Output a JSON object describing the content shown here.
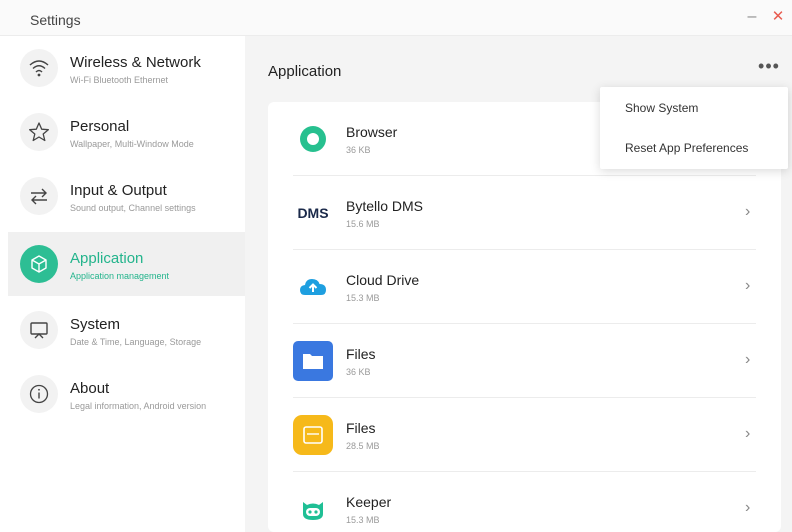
{
  "window": {
    "title": "Settings",
    "minimize_icon": "minimize-icon",
    "close_icon": "close-icon"
  },
  "sidebar": {
    "items": [
      {
        "title": "Wireless & Network",
        "subtitle": "Wi-Fi Bluetooth Ethernet",
        "icon": "wifi-icon",
        "active": false
      },
      {
        "title": "Personal",
        "subtitle": "Wallpaper, Multi-Window Mode",
        "icon": "star-icon",
        "active": false
      },
      {
        "title": "Input & Output",
        "subtitle": "Sound output, Channel settings",
        "icon": "swap-arrows-icon",
        "active": false
      },
      {
        "title": "Application",
        "subtitle": "Application management",
        "icon": "cube-icon",
        "active": true
      },
      {
        "title": "System",
        "subtitle": "Date & Time, Language, Storage",
        "icon": "monitor-icon",
        "active": false
      },
      {
        "title": "About",
        "subtitle": "Legal information, Android version",
        "icon": "info-icon",
        "active": false
      }
    ]
  },
  "main": {
    "title": "Application",
    "more_label": "•••",
    "apps": [
      {
        "name": "Browser",
        "size": "36 KB",
        "icon": "browser-icon"
      },
      {
        "name": "Bytello DMS",
        "size": "15.6 MB",
        "icon": "dms-icon",
        "icon_text": "DMS"
      },
      {
        "name": "Cloud Drive",
        "size": "15.3 MB",
        "icon": "cloud-drive-icon"
      },
      {
        "name": "Files",
        "size": "36 KB",
        "icon": "folder-icon"
      },
      {
        "name": "Files",
        "size": "28.5 MB",
        "icon": "files-yellow-icon"
      },
      {
        "name": "Keeper",
        "size": "15.3 MB",
        "icon": "keeper-icon"
      }
    ],
    "chevron": "›"
  },
  "menu": {
    "items": [
      "Show System",
      "Reset App Preferences"
    ]
  },
  "colors": {
    "accent": "#2dbe94",
    "close": "#e85b4f"
  }
}
